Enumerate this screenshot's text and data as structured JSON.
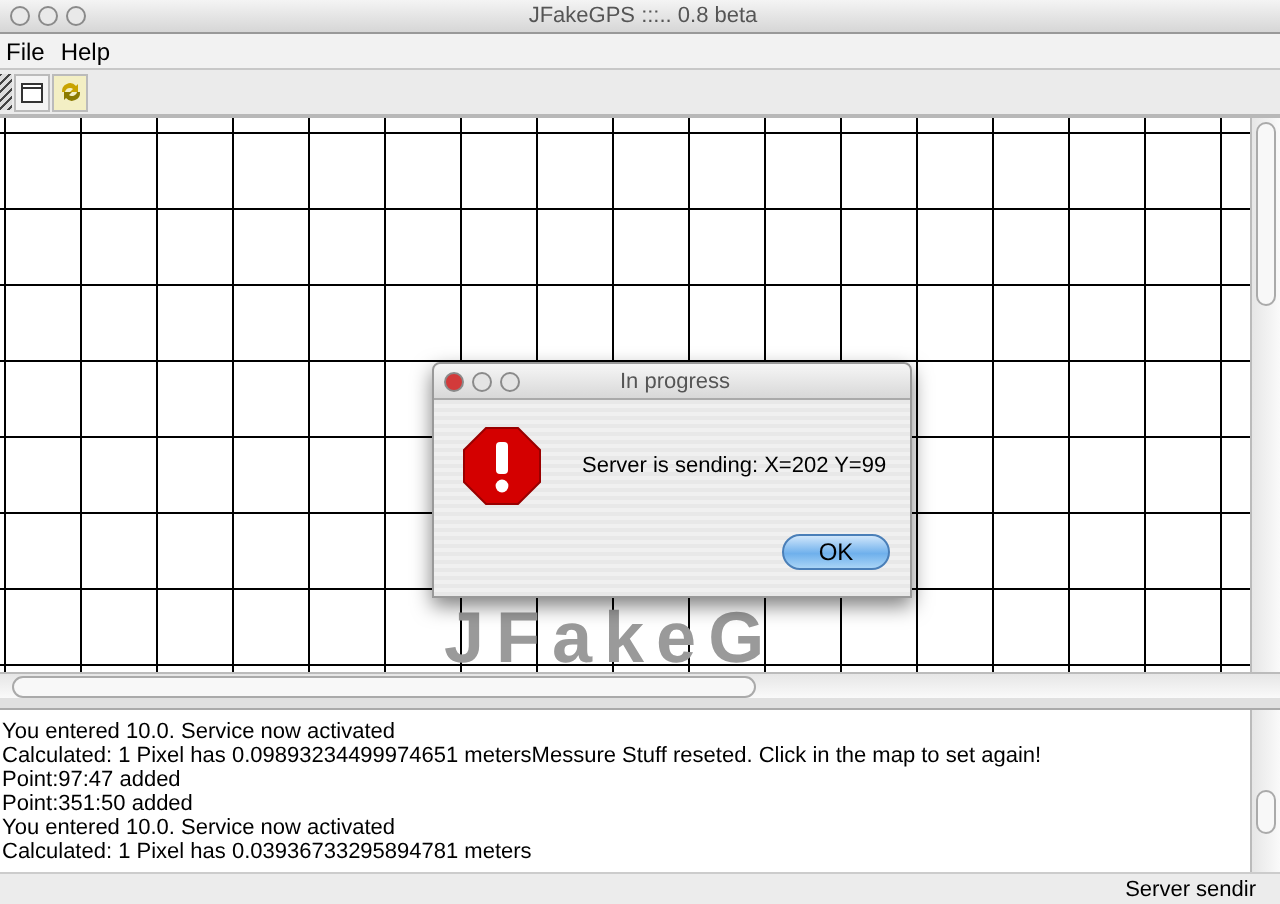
{
  "window": {
    "title": "JFakeGPS :::.. 0.8 beta"
  },
  "menu": [
    "File",
    "Help"
  ],
  "map": {
    "logo": "JFakeG"
  },
  "dialog": {
    "title": "In progress",
    "message": "Server is sending: X=202 Y=99",
    "button": "OK"
  },
  "log": {
    "lines": [
      "You entered 10.0. Service now activated",
      "Calculated: 1 Pixel has 0.09893234499974651 metersMessure Stuff reseted. Click in the map to set again!",
      "Point:97:47 added",
      "Point:351:50 added",
      "You entered 10.0. Service now activated",
      "Calculated: 1 Pixel has 0.03936733295894781 meters"
    ]
  },
  "status_bar": {
    "text": "Server sendir"
  }
}
